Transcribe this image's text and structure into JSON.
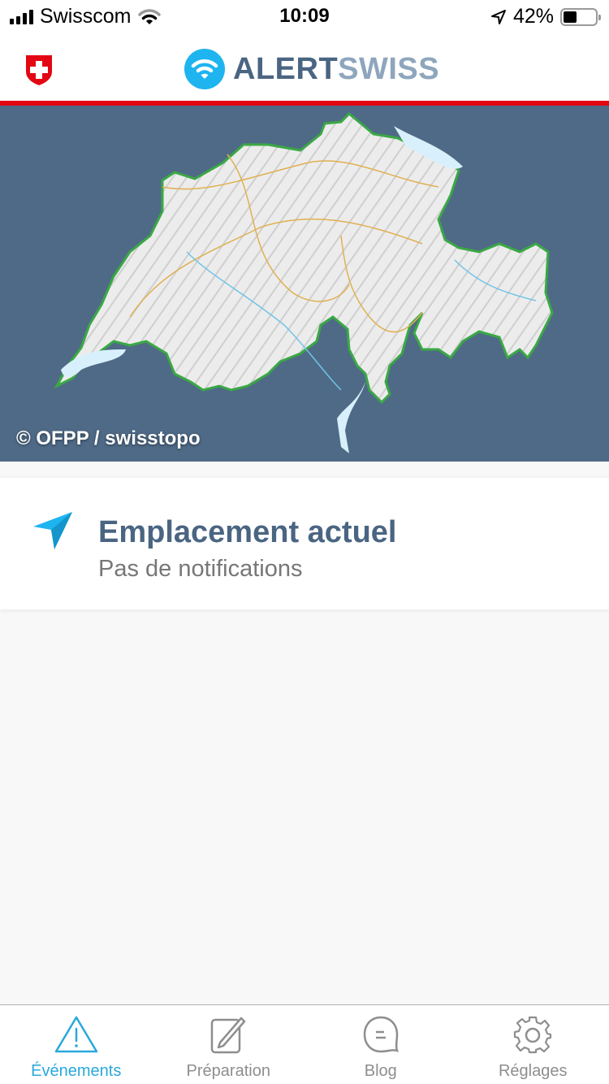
{
  "status_bar": {
    "carrier": "Swisscom",
    "time": "10:09",
    "battery_percent": "42%",
    "battery_level": 0.42
  },
  "header": {
    "logo_part1": "ALERT",
    "logo_part2": "SWISS",
    "shield_icon": "swiss-shield-icon"
  },
  "colors": {
    "accent": "#1eb4f0",
    "brand_dark": "#4a6582",
    "brand_light": "#8ea6bd",
    "red_line": "#e30613",
    "map_background": "#4f6a87",
    "active_tab": "#2aa8dc",
    "inactive_tab": "#8e8e8e"
  },
  "map": {
    "credit": "© OFPP / swisstopo"
  },
  "location": {
    "title": "Emplacement actuel",
    "subtitle": "Pas de notifications",
    "icon": "location-arrow-icon"
  },
  "tabbar": {
    "tabs": [
      {
        "label": "Événements",
        "icon": "warning-triangle-icon",
        "active": true
      },
      {
        "label": "Préparation",
        "icon": "edit-note-icon",
        "active": false
      },
      {
        "label": "Blog",
        "icon": "chat-bubble-icon",
        "active": false
      },
      {
        "label": "Réglages",
        "icon": "gear-icon",
        "active": false
      }
    ]
  }
}
